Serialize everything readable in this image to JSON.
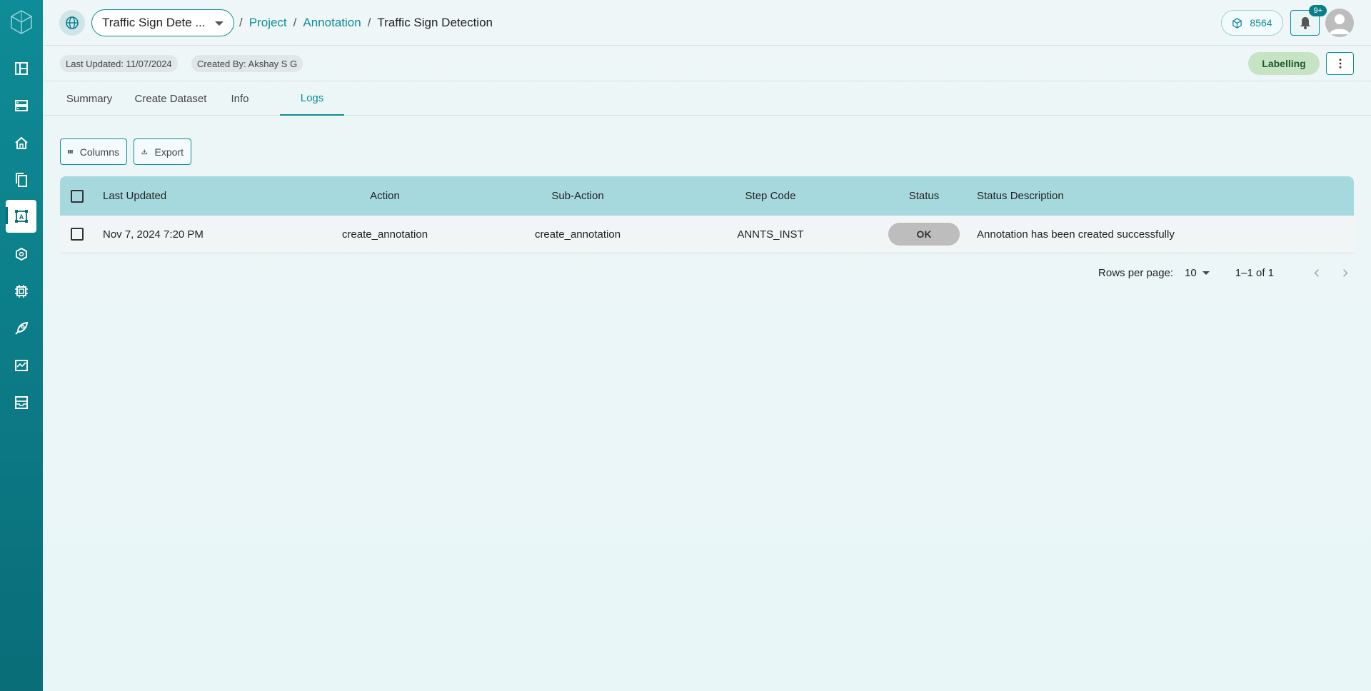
{
  "colors": {
    "accent": "#0e8c97",
    "sidebar": "#0a6d78",
    "header_row": "#a6d9de",
    "status_green": "#c6e4c4",
    "ok_gray": "#bdbdbd"
  },
  "sidebar": {
    "items": [
      {
        "name": "dashboard-icon"
      },
      {
        "name": "storage-icon"
      },
      {
        "name": "home-icon"
      },
      {
        "name": "files-icon"
      },
      {
        "name": "annotation-icon"
      },
      {
        "name": "model-icon"
      },
      {
        "name": "chip-icon"
      },
      {
        "name": "rocket-icon"
      },
      {
        "name": "monitor-icon"
      },
      {
        "name": "inbox-icon"
      }
    ],
    "active_index": 4
  },
  "header": {
    "project_select": "Traffic Sign Dete ...",
    "breadcrumb": {
      "project": "Project",
      "annotation": "Annotation",
      "current": "Traffic Sign Detection",
      "sep": "/"
    },
    "credits": "8564",
    "notifications_badge": "9+"
  },
  "meta": {
    "last_updated": "Last Updated: 11/07/2024",
    "created_by": "Created By: Akshay S G",
    "status": "Labelling"
  },
  "tabs": [
    {
      "label": "Summary"
    },
    {
      "label": "Create Dataset"
    },
    {
      "label": "Info"
    },
    {
      "label": "Logs"
    }
  ],
  "active_tab": "Logs",
  "toolbar": {
    "columns_label": "Columns",
    "export_label": "Export"
  },
  "table": {
    "columns": [
      "Last Updated",
      "Action",
      "Sub-Action",
      "Step Code",
      "Status",
      "Status Description"
    ],
    "rows": [
      {
        "last_updated": "Nov 7, 2024 7:20 PM",
        "action": "create_annotation",
        "sub_action": "create_annotation",
        "step_code": "ANNTS_INST",
        "status": "OK",
        "status_description": "Annotation has been created successfully"
      }
    ]
  },
  "pagination": {
    "rows_label": "Rows per page:",
    "rows_value": "10",
    "range": "1–1 of 1"
  }
}
